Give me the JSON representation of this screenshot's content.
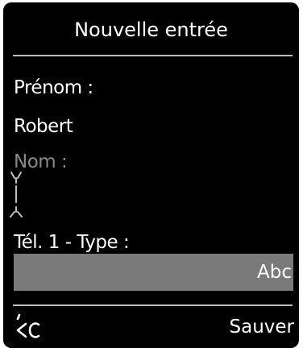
{
  "header": {
    "title": "Nouvelle entrée"
  },
  "form": {
    "first_name_label": "Prénom :",
    "first_name_value": "Robert",
    "last_name_label": "Nom :",
    "phone_type_label": "Tél. 1 - Type :",
    "phone_type_value": "Abc"
  },
  "softkeys": {
    "left_icon": "backspace-clear-icon",
    "right_label": "Sauver"
  },
  "colors": {
    "background": "#000000",
    "text": "#ffffff",
    "inactive_label": "#8a8a8a",
    "selection_bar": "#7a7a7a",
    "divider": "#bdbdbd"
  }
}
